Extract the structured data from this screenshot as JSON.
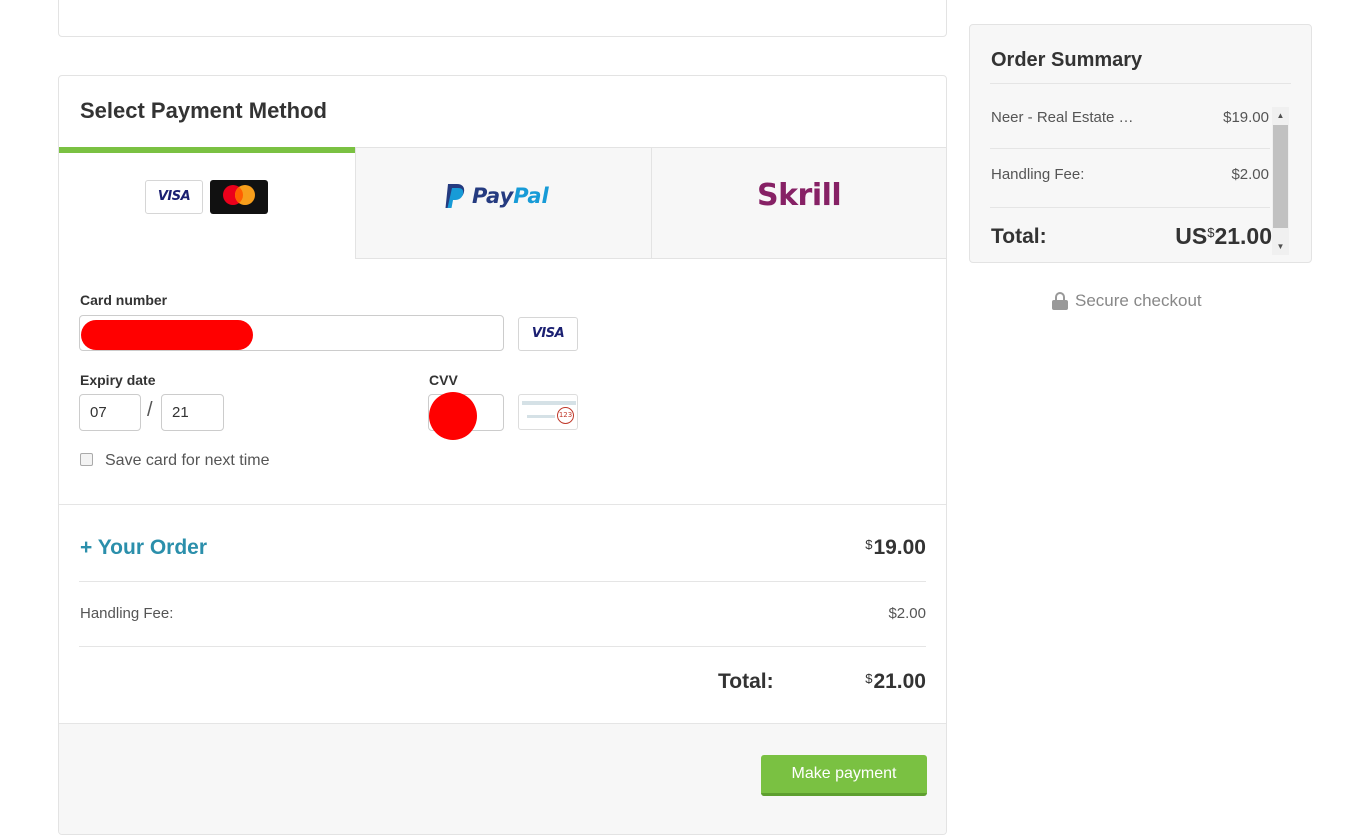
{
  "payment": {
    "title": "Select Payment Method",
    "methods": {
      "card": {
        "visa": "VISA",
        "mastercard_caption": "mastercard"
      },
      "paypal": {
        "pay": "Pay",
        "pal": "Pal"
      },
      "skrill": "Skrill"
    },
    "card_number_label": "Card number",
    "card_brand": "VISA",
    "expiry_label": "Expiry date",
    "expiry_month": "07",
    "expiry_separator": "/",
    "expiry_year": "21",
    "cvv_label": "CVV",
    "cvv_hint": "123",
    "save_card_label": "Save card for next time",
    "save_card_checked": false
  },
  "order": {
    "your_order_label": "+ Your Order",
    "subtotal_currency": "$",
    "subtotal": "19.00",
    "handling_label": "Handling Fee:",
    "handling": "$2.00",
    "total_label": "Total:",
    "total_currency": "$",
    "total": "21.00",
    "pay_button": "Make payment"
  },
  "summary": {
    "title": "Order Summary",
    "item_name": "Neer - Real Estate …",
    "item_price": "$19.00",
    "handling_label": "Handling Fee:",
    "handling": "$2.00",
    "total_label": "Total:",
    "total_prefix": "US",
    "total_currency": "$",
    "total": "21.00",
    "secure_label": "Secure checkout"
  },
  "colors": {
    "accent_green": "#7ac142",
    "link_teal": "#2b8fab",
    "redaction": "#ff0000"
  }
}
